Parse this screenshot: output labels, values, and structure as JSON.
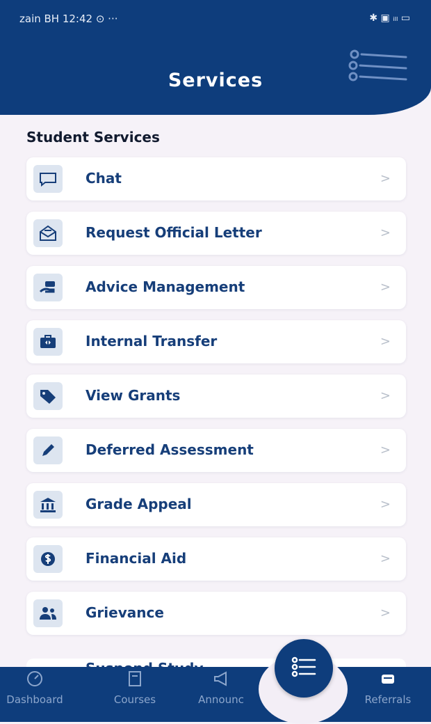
{
  "status_bar": {
    "left": "zain BH  12:42  ⊙  ···",
    "right": "✱ ▣ ᵢₗₗ ▭"
  },
  "header": {
    "title": "Services"
  },
  "section": {
    "title": "Student Services"
  },
  "items": [
    {
      "label": "Chat",
      "icon": "chat-icon"
    },
    {
      "label": "Request Official Letter",
      "icon": "envelope-letter-icon"
    },
    {
      "label": "Advice Management",
      "icon": "advice-icon"
    },
    {
      "label": "Internal Transfer",
      "icon": "transfer-icon"
    },
    {
      "label": "View Grants",
      "icon": "tag-icon"
    },
    {
      "label": "Deferred Assessment",
      "icon": "pencil-icon"
    },
    {
      "label": "Grade Appeal",
      "icon": "court-icon"
    },
    {
      "label": "Financial Aid",
      "icon": "dollar-icon"
    },
    {
      "label": "Grievance",
      "icon": "people-icon"
    },
    {
      "label": "Suspend Study",
      "icon": "person-icon"
    }
  ],
  "nav": {
    "dashboard": "Dashboard",
    "courses": "Courses",
    "announcements": "Announc",
    "referrals": "Referrals"
  },
  "colors": {
    "primary": "#0e3d7c",
    "item_bg": "#ffffff",
    "page_bg": "#f6f2f8"
  }
}
